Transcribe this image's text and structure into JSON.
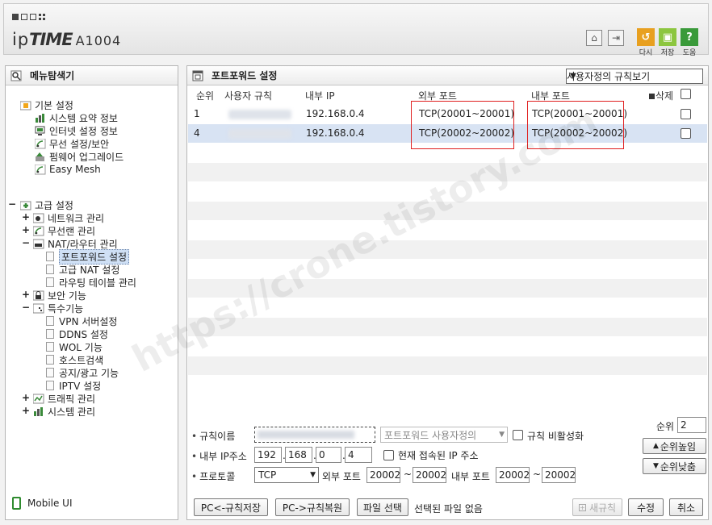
{
  "header": {
    "brand_prefix": "ip",
    "brand_bold": "TIME",
    "model": "A1004",
    "buttons": [
      {
        "label": "다시",
        "icon": "refresh-icon",
        "color": "#e8a020"
      },
      {
        "label": "저장",
        "icon": "save-icon",
        "color": "#8cc63f"
      },
      {
        "label": "도움",
        "icon": "help-icon",
        "color": "#3a9a3a"
      }
    ],
    "home_icon": "home-icon",
    "logout_icon": "logout-icon"
  },
  "sidebar": {
    "title": "메뉴탐색기",
    "groups": [
      {
        "label": "기본 설정",
        "items": [
          "시스템 요약 정보",
          "인터넷 설정 정보",
          "무선 설정/보안",
          "펌웨어 업그레이드",
          "Easy Mesh"
        ]
      },
      {
        "label": "고급 설정",
        "items": [
          {
            "label": "네트워크 관리",
            "toggle": "+"
          },
          {
            "label": "무선랜 관리",
            "toggle": "+"
          },
          {
            "label": "NAT/라우터 관리",
            "toggle": "-",
            "children": [
              "포트포워드 설정",
              "고급 NAT 설정",
              "라우팅 테이블 관리"
            ]
          },
          {
            "label": "보안 기능",
            "toggle": "+"
          },
          {
            "label": "특수기능",
            "toggle": "-",
            "children": [
              "VPN 서버설정",
              "DDNS 설정",
              "WOL 기능",
              "호스트검색",
              "공지/광고 기능",
              "IPTV 설정"
            ]
          },
          {
            "label": "트래픽 관리",
            "toggle": "+"
          },
          {
            "label": "시스템 관리",
            "toggle": "+"
          }
        ]
      }
    ],
    "mobile_label": "Mobile UI"
  },
  "main": {
    "title": "포트포워드 설정",
    "view_select": "사용자정의 규칙보기",
    "columns": {
      "order": "순위",
      "rule": "사용자 규칙",
      "internal_ip": "내부 IP",
      "external_port": "외부 포트",
      "internal_port": "내부 포트",
      "delete": "삭제"
    },
    "rows": [
      {
        "order": "1",
        "internal_ip": "192.168.0.4",
        "external_port": "TCP(20001~20001)",
        "internal_port": "TCP(20001~20001)"
      },
      {
        "order": "4",
        "internal_ip": "192.168.0.4",
        "external_port": "TCP(20002~20002)",
        "internal_port": "TCP(20002~20002)"
      }
    ],
    "form": {
      "rule_name_label": "규칙이름",
      "preset_select": "포트포워드 사용자정의",
      "disable_rule_label": "규칙 비활성화",
      "ip_label": "내부 IP주소",
      "ip": [
        "192",
        "168",
        "0",
        "4"
      ],
      "current_ip_label": "현재 접속된 IP 주소",
      "protocol_label": "프로토콜",
      "protocol": "TCP",
      "ext_port_label": "외부 포트",
      "ext_port_from": "20002",
      "ext_port_to": "20002",
      "int_port_label": "내부 포트",
      "int_port_from": "20002",
      "int_port_to": "20002",
      "tilde": "~",
      "order_label": "순위",
      "order_value": "2",
      "order_up": "순위높임",
      "order_down": "순위낮춤"
    },
    "buttons": {
      "save_to_pc": "PC<-규칙저장",
      "restore_from_pc": "PC->규칙복원",
      "file_select": "파일 선택",
      "file_status": "선택된 파일 없음",
      "new_rule": "새규칙",
      "modify": "수정",
      "cancel": "취소"
    }
  },
  "watermark": "https://crone.tistory.com"
}
